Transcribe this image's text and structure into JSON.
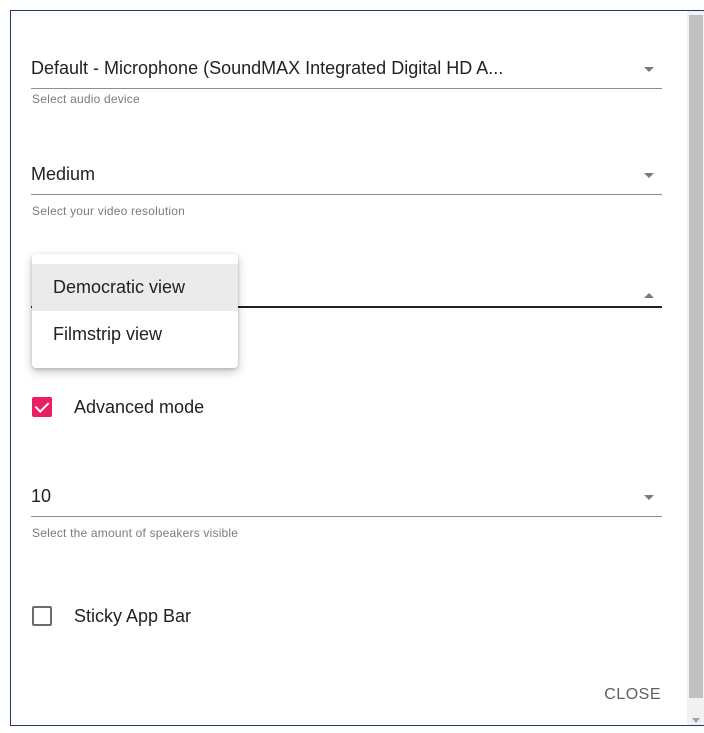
{
  "audio": {
    "value": "Default - Microphone (SoundMAX Integrated Digital HD A...",
    "helper": "Select audio device"
  },
  "resolution": {
    "value": "Medium",
    "helper": "Select your video resolution"
  },
  "layout": {
    "options": [
      "Democratic view",
      "Filmstrip view"
    ]
  },
  "advanced_mode": {
    "label": "Advanced mode",
    "checked": true
  },
  "speakers": {
    "value": "10",
    "helper": "Select the amount of speakers visible"
  },
  "sticky_app_bar": {
    "label": "Sticky App Bar",
    "checked": false
  },
  "actions": {
    "close_label": "CLOSE"
  },
  "colors": {
    "accent": "#e91e63",
    "frame_border": "#1f3b6a"
  }
}
